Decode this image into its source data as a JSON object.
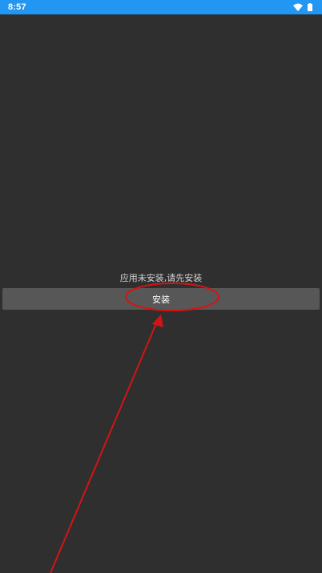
{
  "status_bar": {
    "time": "8:57",
    "background": "#2196f3",
    "icons": [
      "wifi-icon",
      "battery-icon"
    ]
  },
  "main": {
    "message": "应用未安装,请先安装",
    "install_button_label": "安装",
    "background": "#2f2f2f",
    "button_background": "#575757"
  },
  "annotation": {
    "color": "#d41414",
    "shapes": [
      "ellipse-highlight",
      "arrow-pointer"
    ]
  }
}
